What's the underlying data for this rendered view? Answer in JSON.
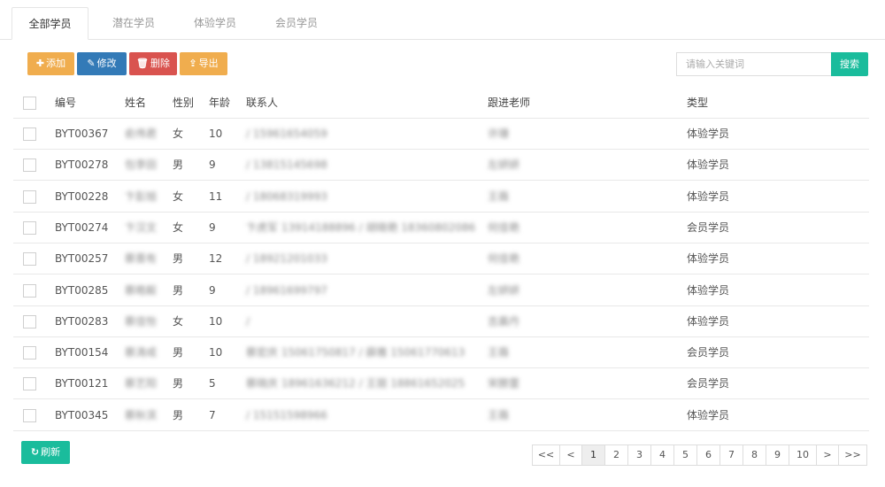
{
  "tabs": [
    "全部学员",
    "潜在学员",
    "体验学员",
    "会员学员"
  ],
  "toolbar": {
    "add_label": "添加",
    "edit_label": "修改",
    "delete_label": "删除",
    "export_label": "导出",
    "search_placeholder": "请输入关键词",
    "search_label": "搜索"
  },
  "table": {
    "columns": [
      "编号",
      "姓名",
      "性别",
      "年龄",
      "联系人",
      "跟进老师",
      "类型"
    ],
    "rows": [
      {
        "id": "BYT00367",
        "name": "俞伟君",
        "gender": "女",
        "age": "10",
        "contact": "/ 15961654059",
        "teacher": "许珊",
        "type": "体验学员"
      },
      {
        "id": "BYT00278",
        "name": "包李田",
        "gender": "男",
        "age": "9",
        "contact": "/ 13815145698",
        "teacher": "左妍妍",
        "type": "体验学员"
      },
      {
        "id": "BYT00228",
        "name": "卞彭旭",
        "gender": "女",
        "age": "11",
        "contact": "/ 18068319993",
        "teacher": "王薇",
        "type": "体验学员"
      },
      {
        "id": "BYT00274",
        "name": "卞汉文",
        "gender": "女",
        "age": "9",
        "contact": "卞虎军 13914188896 / 胡晓艳 18360802086",
        "teacher": "何佳艳",
        "type": "会员学员"
      },
      {
        "id": "BYT00257",
        "name": "蔡晋有",
        "gender": "男",
        "age": "12",
        "contact": "/ 18921201033",
        "teacher": "何佳艳",
        "type": "体验学员"
      },
      {
        "id": "BYT00285",
        "name": "蔡皓毅",
        "gender": "男",
        "age": "9",
        "contact": "/ 18961699797",
        "teacher": "左妍妍",
        "type": "体验学员"
      },
      {
        "id": "BYT00283",
        "name": "蔡佳怡",
        "gender": "女",
        "age": "10",
        "contact": "/",
        "teacher": "吉晨丹",
        "type": "体验学员"
      },
      {
        "id": "BYT00154",
        "name": "蔡涛成",
        "gender": "男",
        "age": "10",
        "contact": "蔡宏庆 15061750817 / 薛雅 15061770613",
        "teacher": "王薇",
        "type": "会员学员"
      },
      {
        "id": "BYT00121",
        "name": "蔡艺阳",
        "gender": "男",
        "age": "5",
        "contact": "蔡晓庆 18961636212 / 王丽 18861652025",
        "teacher": "宋膀蕾",
        "type": "会员学员"
      },
      {
        "id": "BYT00345",
        "name": "蔡秋滨",
        "gender": "男",
        "age": "7",
        "contact": "/ 15151598966",
        "teacher": "王薇",
        "type": "体验学员"
      }
    ]
  },
  "footer": {
    "refresh_label": "刷新"
  },
  "pagination": {
    "items": [
      "<<",
      "<",
      "1",
      "2",
      "3",
      "4",
      "5",
      "6",
      "7",
      "8",
      "9",
      "10",
      ">",
      ">>"
    ],
    "active": "1"
  },
  "colors": {
    "add": "#f0ad4e",
    "edit": "#337ab7",
    "delete": "#d9534f",
    "export": "#f0ad4e",
    "search": "#1abc9c",
    "refresh": "#1abc9c"
  },
  "icons": {
    "add": "plus-icon",
    "edit": "edit-icon",
    "delete": "trash-icon",
    "export": "export-icon",
    "refresh": "refresh-icon"
  }
}
